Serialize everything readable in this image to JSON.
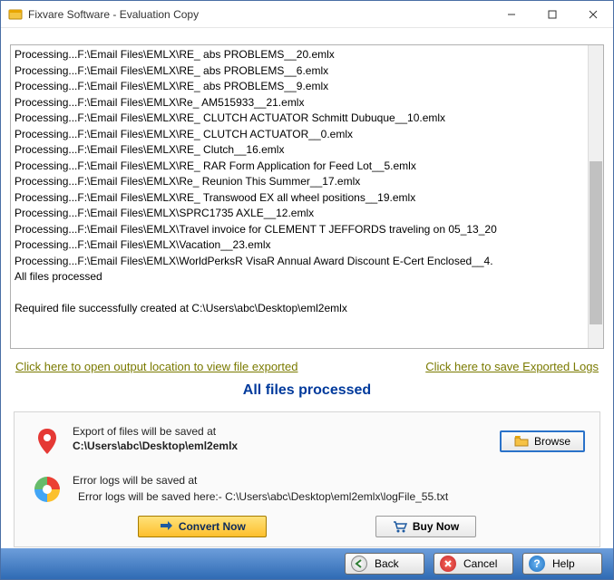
{
  "window": {
    "title": "Fixvare Software - Evaluation Copy"
  },
  "stub": "",
  "log_lines": [
    "Processing...F:\\Email Files\\EMLX\\RE_ abs PROBLEMS__20.emlx",
    "Processing...F:\\Email Files\\EMLX\\RE_ abs PROBLEMS__6.emlx",
    "Processing...F:\\Email Files\\EMLX\\RE_ abs PROBLEMS__9.emlx",
    "Processing...F:\\Email Files\\EMLX\\Re_ AM515933__21.emlx",
    "Processing...F:\\Email Files\\EMLX\\RE_ CLUTCH ACTUATOR Schmitt Dubuque__10.emlx",
    "Processing...F:\\Email Files\\EMLX\\RE_ CLUTCH ACTUATOR__0.emlx",
    "Processing...F:\\Email Files\\EMLX\\RE_ Clutch__16.emlx",
    "Processing...F:\\Email Files\\EMLX\\RE_ RAR Form Application for Feed Lot__5.emlx",
    "Processing...F:\\Email Files\\EMLX\\Re_ Reunion This Summer__17.emlx",
    "Processing...F:\\Email Files\\EMLX\\RE_ Transwood EX all wheel positions__19.emlx",
    "Processing...F:\\Email Files\\EMLX\\SPRC1735 AXLE__12.emlx",
    "Processing...F:\\Email Files\\EMLX\\Travel invoice for CLEMENT T JEFFORDS traveling on 05_13_20",
    "Processing...F:\\Email Files\\EMLX\\Vacation__23.emlx",
    "Processing...F:\\Email Files\\EMLX\\WorldPerksR VisaR Annual Award Discount E-Cert Enclosed__4.",
    "All files processed",
    "",
    "Required file successfully created at C:\\Users\\abc\\Desktop\\eml2emlx"
  ],
  "links": {
    "open_location": "Click here to open output location to view file exported",
    "save_logs": "Click here to save Exported Logs"
  },
  "status": "All files processed",
  "export_section": {
    "label": "Export of files will be saved at",
    "path": "C:\\Users\\abc\\Desktop\\eml2emlx",
    "browse": "Browse"
  },
  "error_section": {
    "label": "Error logs will be saved at",
    "path": "Error logs will be saved here:- C:\\Users\\abc\\Desktop\\eml2emlx\\logFile_55.txt"
  },
  "actions": {
    "convert": "Convert Now",
    "buy": "Buy Now"
  },
  "footer": {
    "back": "Back",
    "cancel": "Cancel",
    "help": "Help"
  }
}
